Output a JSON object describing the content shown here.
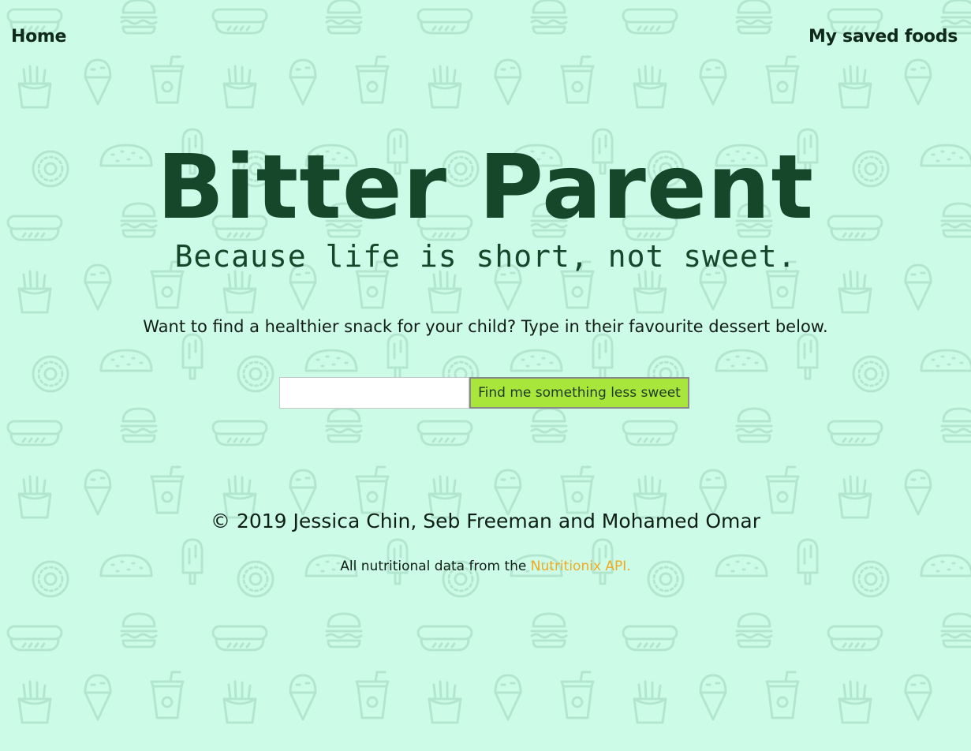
{
  "nav": {
    "home_label": "Home",
    "saved_label": "My saved foods"
  },
  "hero": {
    "title": "Bitter Parent",
    "tagline": "Because life is short, not sweet."
  },
  "search": {
    "prompt": "Want to find a healthier snack for your child? Type in their favourite dessert below.",
    "input_value": "",
    "input_placeholder": "",
    "button_label": "Find me something less sweet"
  },
  "footer": {
    "copyright": "© 2019 Jessica Chin, Seb Freeman and Mohamed Omar",
    "credit_prefix": "All nutritional data from the ",
    "credit_link": "Nutritionix API."
  },
  "colors": {
    "background": "#ccfce8",
    "pattern": "#b3e6cf",
    "title": "#17472a",
    "button": "#a8e63b",
    "link_accent": "#f2a91f"
  },
  "background_icons": [
    "hot-dog-icon",
    "burger-icon",
    "fries-icon",
    "ice-cream-icon",
    "soda-cup-icon",
    "taco-icon",
    "donut-icon",
    "popsicle-icon"
  ]
}
